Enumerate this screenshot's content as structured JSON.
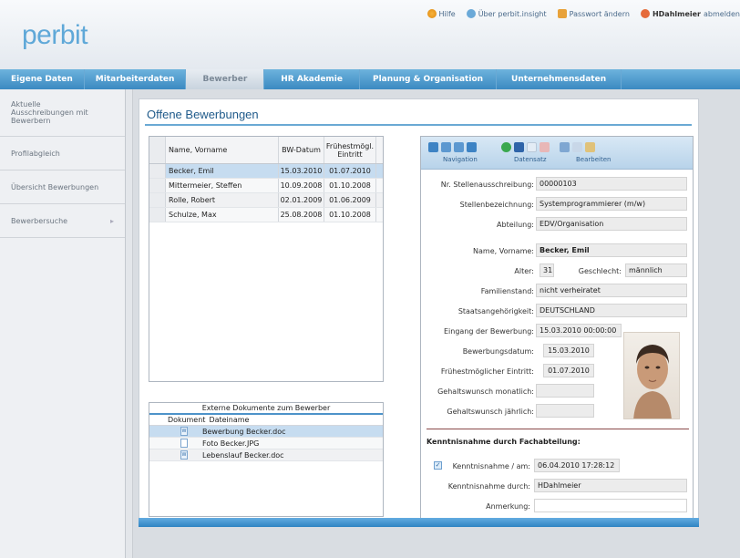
{
  "header": {
    "logo": "perbit",
    "links": [
      {
        "label": "Hilfe",
        "icon": "help-icon"
      },
      {
        "label": "Über perbit.insight",
        "icon": "info-icon"
      },
      {
        "label": "Passwort ändern",
        "icon": "key-icon"
      },
      {
        "label": "HDahlmeier",
        "label2": "abmelden",
        "icon": "user-icon"
      }
    ]
  },
  "nav": {
    "tabs": [
      "Eigene Daten",
      "Mitarbeiterdaten",
      "Bewerber",
      "HR Akademie",
      "Planung & Organisation",
      "Unternehmensdaten"
    ],
    "active": "Bewerber"
  },
  "sidebar": {
    "items": [
      "Aktuelle Ausschreibungen mit Bewerbern",
      "Profilabgleich",
      "Übersicht Bewerbungen",
      "Bewerbersuche"
    ]
  },
  "page": {
    "title": "Offene Bewerbungen"
  },
  "applicants": {
    "columns": [
      "Name, Vorname",
      "BW-Datum",
      "Frühestmögl. Eintritt"
    ],
    "rows": [
      [
        "Becker, Emil",
        "15.03.2010",
        "01.07.2010"
      ],
      [
        "Mittermeier, Steffen",
        "10.09.2008",
        "01.10.2008"
      ],
      [
        "Rolle, Robert",
        "02.01.2009",
        "01.06.2009"
      ],
      [
        "Schulze, Max",
        "25.08.2008",
        "01.10.2008"
      ]
    ]
  },
  "documents": {
    "title": "Externe Dokumente zum Bewerber",
    "columns": [
      "Dokument",
      "Dateiname"
    ],
    "rows": [
      "Bewerbung Becker.doc",
      "Foto Becker.JPG",
      "Lebenslauf Becker.doc"
    ]
  },
  "toolbar": {
    "groups": [
      "Navigation",
      "Datensatz",
      "Bearbeiten"
    ]
  },
  "form": {
    "stellenausschreibung": {
      "label": "Nr. Stellenausschreibung:",
      "value": "00000103"
    },
    "stellenbezeichnung": {
      "label": "Stellenbezeichnung:",
      "value": "Systemprogrammierer (m/w)"
    },
    "abteilung": {
      "label": "Abteilung:",
      "value": "EDV/Organisation"
    },
    "name": {
      "label": "Name, Vorname:",
      "value": "Becker, Emil"
    },
    "alter": {
      "label": "Alter:",
      "value": "31"
    },
    "geschlecht": {
      "label": "Geschlecht:",
      "value": "männlich"
    },
    "familienstand": {
      "label": "Familienstand:",
      "value": "nicht verheiratet"
    },
    "staat": {
      "label": "Staatsangehörigkeit:",
      "value": "DEUTSCHLAND"
    },
    "eingang": {
      "label": "Eingang der Bewerbung:",
      "value": "15.03.2010 00:00:00"
    },
    "bwdatum": {
      "label": "Bewerbungsdatum:",
      "value": "15.03.2010"
    },
    "eintritt": {
      "label": "Frühestmöglicher Eintritt:",
      "value": "01.07.2010"
    },
    "gehaltm": {
      "label": "Gehaltswunsch monatlich:",
      "value": ""
    },
    "gehaltj": {
      "label": "Gehaltswunsch jährlich:",
      "value": ""
    },
    "section": "Kenntnisnahme durch Fachabteilung:",
    "kenntnis": {
      "label": "Kenntnisnahme / am:",
      "value": "06.04.2010 17:28:12",
      "checked": true
    },
    "durch": {
      "label": "Kenntnisnahme durch:",
      "value": "HDahlmeier"
    },
    "anmerkung": {
      "label": "Anmerkung:",
      "value": ""
    }
  }
}
